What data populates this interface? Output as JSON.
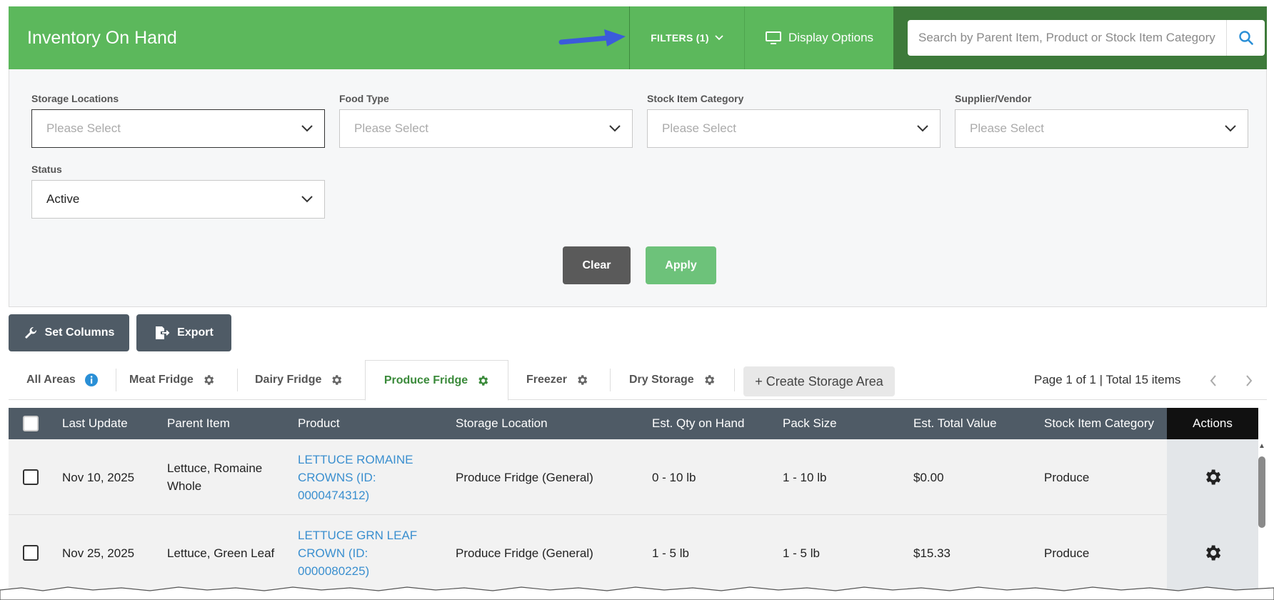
{
  "header": {
    "title": "Inventory On Hand",
    "filters_label": "FILTERS (1)",
    "display_options_label": "Display Options",
    "search_placeholder": "Search by Parent Item, Product or Stock Item Category"
  },
  "filters": {
    "storage_locations": {
      "label": "Storage Locations",
      "placeholder": "Please Select"
    },
    "food_type": {
      "label": "Food Type",
      "placeholder": "Please Select"
    },
    "stock_item_category": {
      "label": "Stock Item Category",
      "placeholder": "Please Select"
    },
    "supplier_vendor": {
      "label": "Supplier/Vendor",
      "placeholder": "Please Select"
    },
    "status": {
      "label": "Status",
      "value": "Active"
    },
    "clear_label": "Clear",
    "apply_label": "Apply"
  },
  "toolbar": {
    "set_columns_label": "Set Columns",
    "export_label": "Export"
  },
  "tabs": [
    {
      "label": "All Areas"
    },
    {
      "label": "Meat Fridge"
    },
    {
      "label": "Dairy Fridge"
    },
    {
      "label": "Produce Fridge"
    },
    {
      "label": "Freezer"
    },
    {
      "label": "Dry Storage"
    }
  ],
  "create_storage_area_label": "+ Create Storage Area",
  "pager_text": "Page 1 of 1 | Total 15 items",
  "table": {
    "columns": [
      "Last Update",
      "Parent Item",
      "Product",
      "Storage Location",
      "Est. Qty on Hand",
      "Pack Size",
      "Est. Total Value",
      "Stock Item Category",
      "Actions"
    ],
    "rows": [
      {
        "last_update": "Nov 10, 2025",
        "parent_item": "Lettuce, Romaine Whole",
        "product": "LETTUCE ROMAINE CROWNS (ID: 0000474312)",
        "storage_location": "Produce Fridge (General)",
        "qty": "0 - 10 lb",
        "pack_size": "1 - 10 lb",
        "total_value": "$0.00",
        "category": "Produce"
      },
      {
        "last_update": "Nov 25, 2025",
        "parent_item": "Lettuce, Green Leaf",
        "product": "LETTUCE GRN LEAF CROWN (ID: 0000080225)",
        "storage_location": "Produce Fridge (General)",
        "qty": "1 - 5 lb",
        "pack_size": "1 - 5 lb",
        "total_value": "$15.33",
        "category": "Produce"
      }
    ]
  },
  "colors": {
    "header_green": "#5cb85c",
    "search_bg": "#3d7a3a",
    "table_header": "#4f5b66",
    "link_blue": "#3a8fcf",
    "arrow_blue": "#3b5bdb"
  }
}
